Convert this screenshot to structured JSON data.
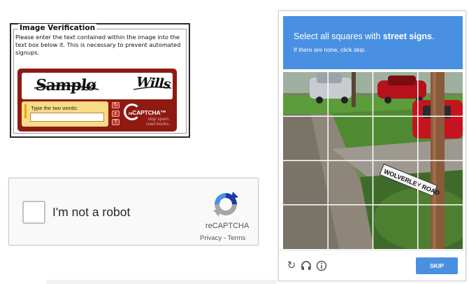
{
  "old_captcha": {
    "legend": "Image Verification",
    "instructions": "Please enter the text contained within the image into the text box below it. This is necessary to prevent automated signups.",
    "image_words": [
      "Samplø",
      "Wills"
    ],
    "input_label": "Type the two words:",
    "input_value": "",
    "logo_prefix": "re",
    "logo_text": "CAPTCHA™",
    "slogan": "stop spam. read books.",
    "icons": [
      "refresh-icon",
      "audio-icon",
      "help-icon"
    ]
  },
  "checkbox_widget": {
    "label": "I'm not a robot",
    "brand": "reCAPTCHA",
    "privacy": "Privacy",
    "separator": " - ",
    "terms": "Terms",
    "checked": false
  },
  "image_challenge": {
    "title_prefix": "Select all squares with ",
    "title_emphasis": "street signs",
    "title_suffix": ".",
    "subtitle": "If there are none, click skip.",
    "grid_rows": 4,
    "grid_cols": 4,
    "sign_text": "WOLVERLEY ROAD",
    "skip_label": "SKIP",
    "header_color": "#4a90e2",
    "icons": [
      "reload-icon",
      "headphones-icon",
      "info-icon"
    ]
  }
}
